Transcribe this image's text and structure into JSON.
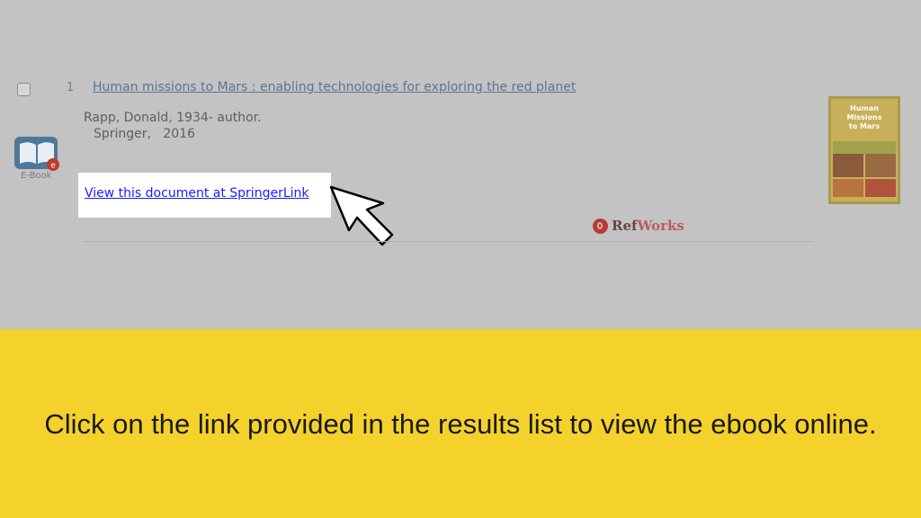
{
  "result": {
    "number": "1",
    "title": "Human missions to Mars : enabling technologies for exploring the red planet",
    "author": "Rapp, Donald, 1934- author.",
    "publisher": "Springer,   2016",
    "format_label": "E-Book",
    "format_icon": "ebook-icon",
    "access_link": "View this document at SpringerLink",
    "refworks_ref": "Ref",
    "refworks_works": "Works",
    "cover_title_line1": "Human",
    "cover_title_line2": "Missions",
    "cover_title_line3": "to Mars"
  },
  "banner": {
    "instruction": "Click on the link provided in the results list to view the ebook online."
  },
  "colors": {
    "overlay_gray": "#c3c3c3",
    "banner_yellow": "#f5d12b",
    "link_blue": "#1a1aff",
    "refworks_red": "#b85d5d"
  }
}
